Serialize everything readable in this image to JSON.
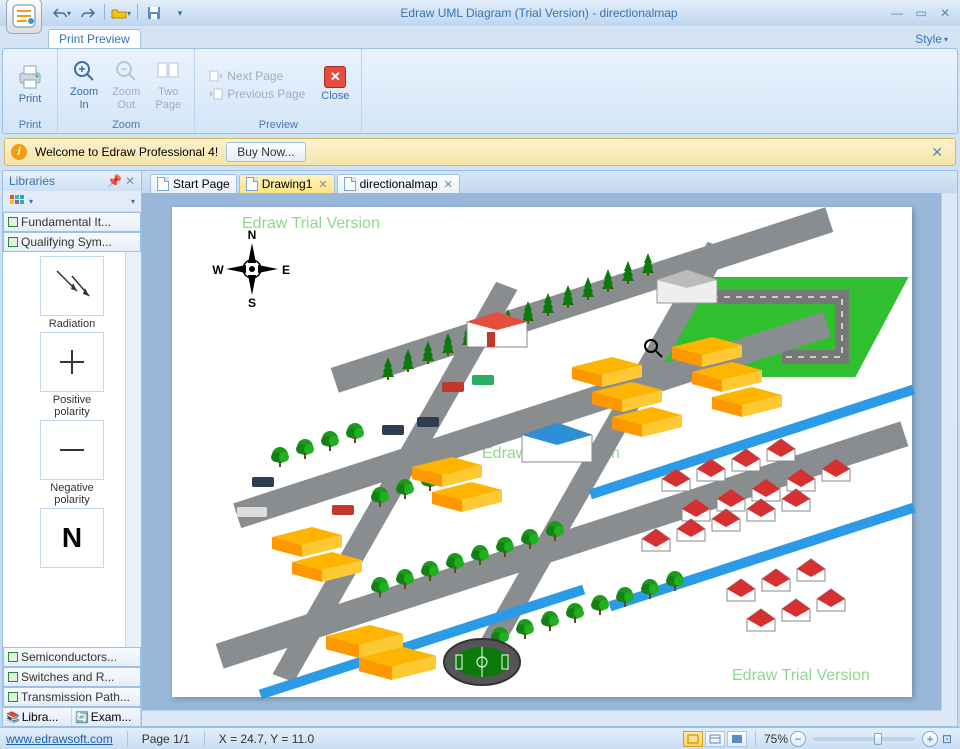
{
  "titlebar": {
    "app_title": "Edraw UML Diagram (Trial Version) - directionalmap"
  },
  "ribbon": {
    "tab_print_preview": "Print Preview",
    "style_menu": "Style",
    "groups": {
      "print": {
        "label": "Print",
        "print_btn": "Print"
      },
      "zoom": {
        "label": "Zoom",
        "zoom_in": "Zoom\nIn",
        "zoom_out": "Zoom\nOut",
        "two_page": "Two\nPage"
      },
      "preview": {
        "label": "Preview",
        "next_page": "Next Page",
        "prev_page": "Previous Page",
        "close": "Close"
      }
    }
  },
  "welcome": {
    "text": "Welcome to Edraw Professional 4!",
    "buy_now": "Buy Now..."
  },
  "libraries": {
    "title": "Libraries",
    "tabs": [
      "Fundamental It...",
      "Qualifying Sym..."
    ],
    "shapes": [
      {
        "label": "Radiation"
      },
      {
        "label": "Positive\npolarity"
      },
      {
        "label": "Negative\npolarity"
      },
      {
        "label": "N"
      }
    ],
    "extra_tabs": [
      "Semiconductors...",
      "Switches and R...",
      "Transmission Path..."
    ],
    "bottom_tabs": [
      "Libra...",
      "Exam..."
    ]
  },
  "doc_tabs": [
    {
      "label": "Start Page",
      "closable": false,
      "active": false
    },
    {
      "label": "Drawing1",
      "closable": true,
      "active": true
    },
    {
      "label": "directionalmap",
      "closable": true,
      "active": false
    }
  ],
  "canvas": {
    "watermarks": [
      "Edraw Trial Version",
      "Edraw Trial Version",
      "Edraw Trial Version"
    ],
    "compass": {
      "n": "N",
      "s": "S",
      "e": "E",
      "w": "W"
    }
  },
  "status": {
    "url": "www.edrawsoft.com",
    "page": "Page 1/1",
    "coords": "X = 24.7, Y = 11.0",
    "zoom": "75%"
  }
}
